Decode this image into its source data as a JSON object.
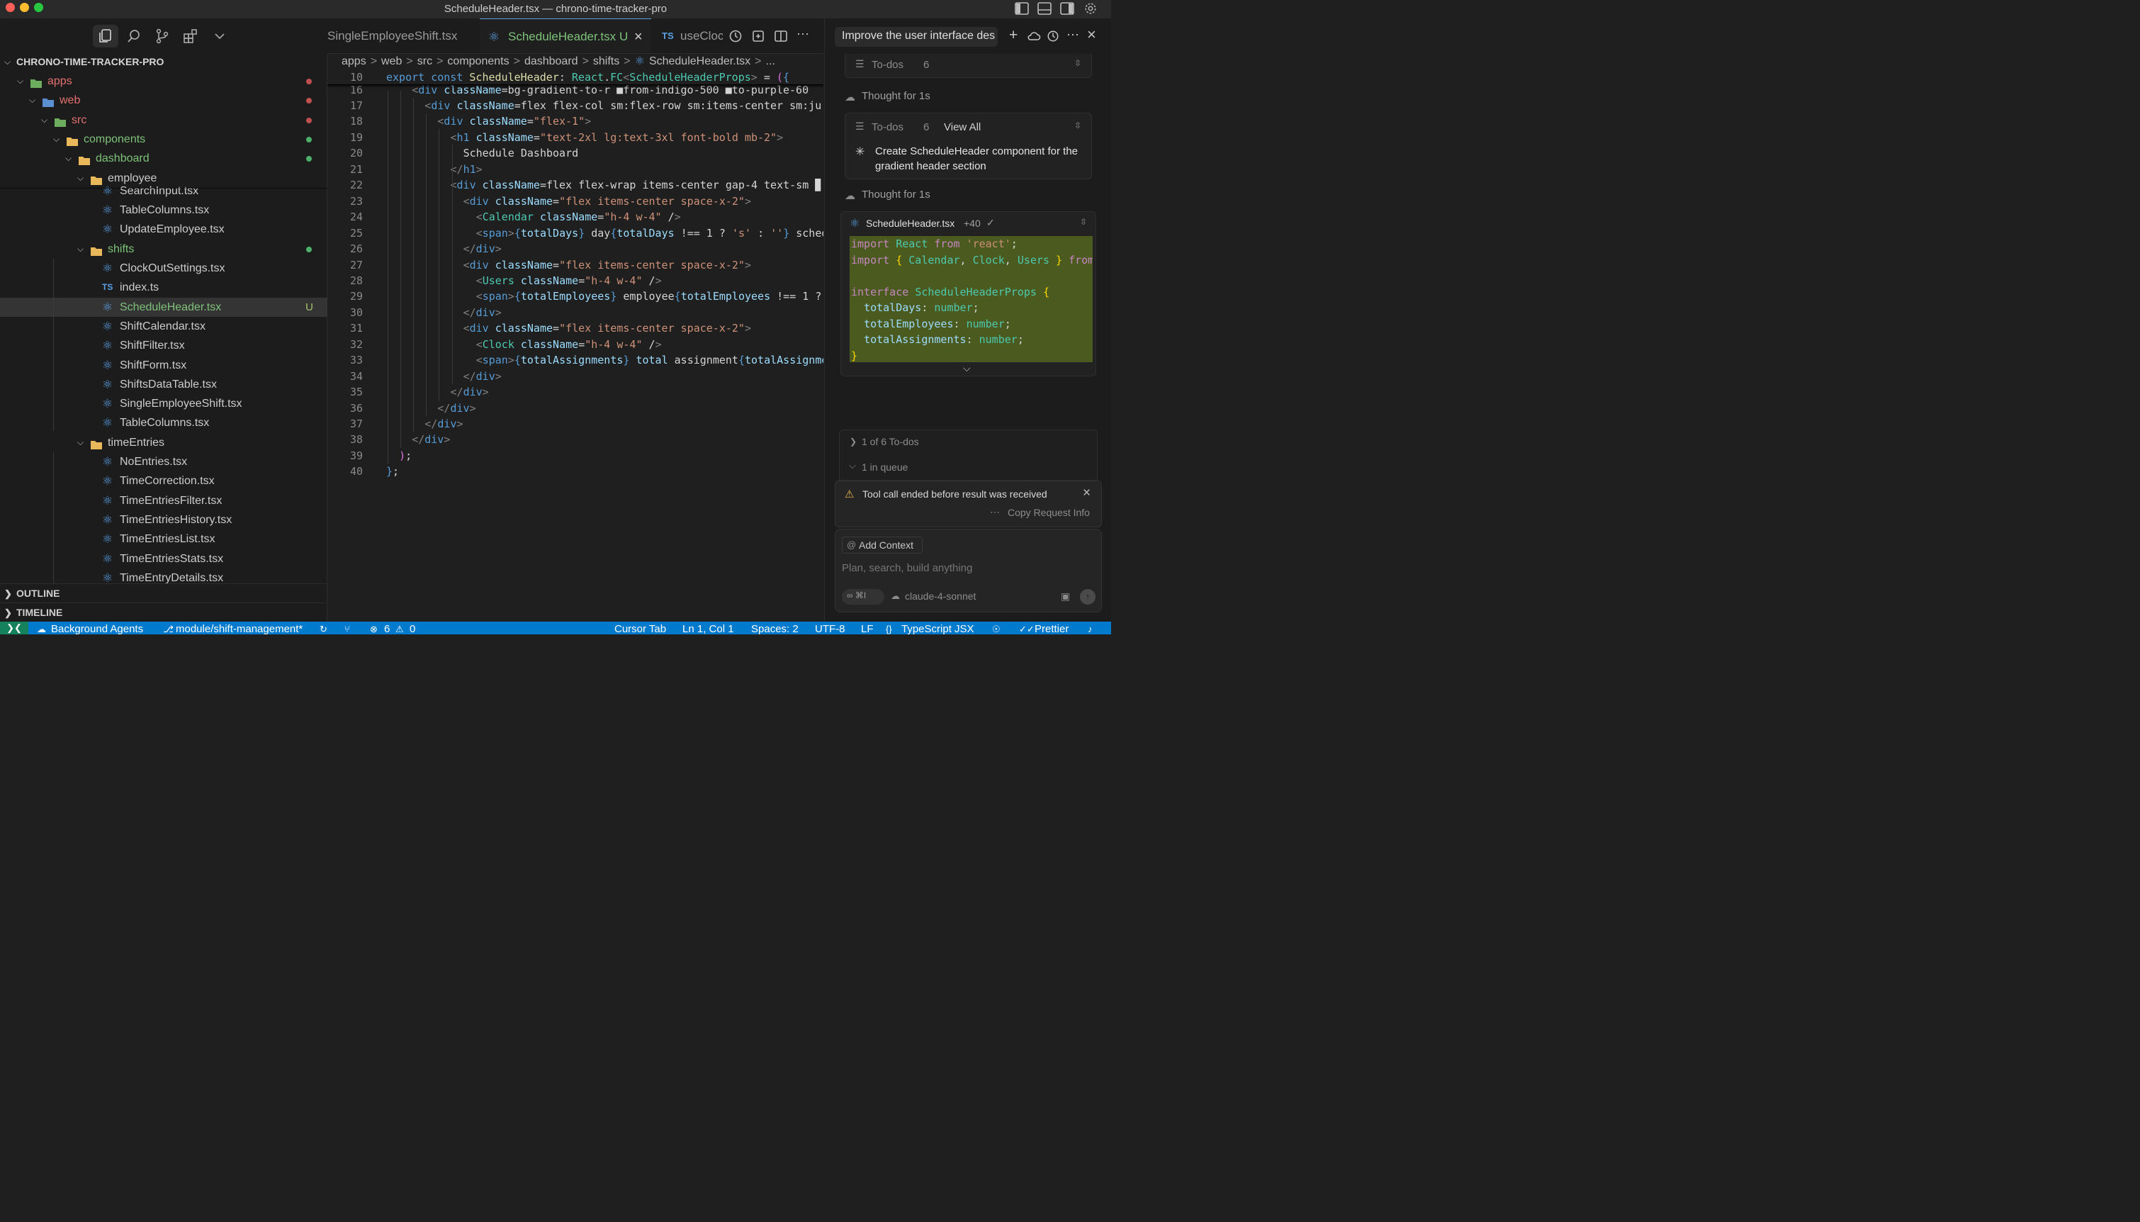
{
  "window": {
    "title": "ScheduleHeader.tsx — chrono-time-tracker-pro"
  },
  "explorer": {
    "root_label": "CHRONO-TIME-TRACKER-PRO",
    "tree": [
      {
        "label": "apps",
        "kind": "folder-apps",
        "open": true,
        "dot": "#c05050",
        "color": "#e46f6f"
      },
      {
        "label": "web",
        "kind": "folder-web",
        "open": true,
        "dot": "#c05050",
        "color": "#e46f6f"
      },
      {
        "label": "src",
        "kind": "folder-src",
        "open": true,
        "dot": "#c05050",
        "color": "#e46f6f"
      },
      {
        "label": "components",
        "kind": "folder-comp",
        "open": true,
        "dot": "#4caf6a",
        "color": "#7ec27a"
      },
      {
        "label": "dashboard",
        "kind": "folder",
        "open": true,
        "dot": "#4caf6a",
        "color": "#7ec27a"
      },
      {
        "label": "employee",
        "kind": "folder",
        "open": true,
        "dot": "",
        "color": "#cccccc"
      },
      {
        "label": "SearchInput.tsx",
        "kind": "react",
        "color": "#cccccc"
      },
      {
        "label": "TableColumns.tsx",
        "kind": "react",
        "color": "#cccccc"
      },
      {
        "label": "UpdateEmployee.tsx",
        "kind": "react",
        "color": "#cccccc"
      },
      {
        "label": "shifts",
        "kind": "folder",
        "open": true,
        "dot": "#4caf6a",
        "color": "#7ec27a"
      },
      {
        "label": "ClockOutSettings.tsx",
        "kind": "react",
        "color": "#cccccc"
      },
      {
        "label": "index.ts",
        "kind": "ts",
        "color": "#cccccc"
      },
      {
        "label": "ScheduleHeader.tsx",
        "kind": "react",
        "color": "#7ec27a",
        "badge": "U",
        "selected": true
      },
      {
        "label": "ShiftCalendar.tsx",
        "kind": "react",
        "color": "#cccccc"
      },
      {
        "label": "ShiftFilter.tsx",
        "kind": "react",
        "color": "#cccccc"
      },
      {
        "label": "ShiftForm.tsx",
        "kind": "react",
        "color": "#cccccc"
      },
      {
        "label": "ShiftsDataTable.tsx",
        "kind": "react",
        "color": "#cccccc"
      },
      {
        "label": "SingleEmployeeShift.tsx",
        "kind": "react",
        "color": "#cccccc"
      },
      {
        "label": "TableColumns.tsx",
        "kind": "react",
        "color": "#cccccc"
      },
      {
        "label": "timeEntries",
        "kind": "folder",
        "open": true,
        "dot": "",
        "color": "#cccccc"
      },
      {
        "label": "NoEntries.tsx",
        "kind": "react",
        "color": "#cccccc"
      },
      {
        "label": "TimeCorrection.tsx",
        "kind": "react",
        "color": "#cccccc"
      },
      {
        "label": "TimeEntriesFilter.tsx",
        "kind": "react",
        "color": "#cccccc"
      },
      {
        "label": "TimeEntriesHistory.tsx",
        "kind": "react",
        "color": "#cccccc"
      },
      {
        "label": "TimeEntriesList.tsx",
        "kind": "react",
        "color": "#cccccc"
      },
      {
        "label": "TimeEntriesStats.tsx",
        "kind": "react",
        "color": "#cccccc"
      },
      {
        "label": "TimeEntryDetails.tsx",
        "kind": "react",
        "color": "#cccccc"
      }
    ],
    "outline_label": "OUTLINE",
    "timeline_label": "TIMELINE"
  },
  "editor": {
    "tabs": [
      {
        "label": "SingleEmployeeShift.tsx",
        "active": false
      },
      {
        "label": "ScheduleHeader.tsx",
        "badge": "U",
        "active": true
      },
      {
        "label": "useCloc",
        "active": false
      }
    ],
    "breadcrumb": [
      "apps",
      "web",
      "src",
      "components",
      "dashboard",
      "shifts",
      "ScheduleHeader.tsx",
      "..."
    ],
    "sticky_line": {
      "no": "10",
      "text": "export const ScheduleHeader: React.FC<ScheduleHeaderProps> = ({"
    },
    "partial_line": {
      "no": "16",
      "text": "<div className=\"bg-gradient-to-r ■from-indigo-500 ■to-purple-60"
    },
    "lines": [
      {
        "no": "17",
        "text": "<div className=\"flex flex-col sm:flex-row sm:items-center sm:ju"
      },
      {
        "no": "18",
        "text": "<div className=\"flex-1\">"
      },
      {
        "no": "19",
        "text": "<h1 className=\"text-2xl lg:text-3xl font-bold mb-2\">"
      },
      {
        "no": "20",
        "text": "Schedule Dashboard"
      },
      {
        "no": "21",
        "text": "</h1>"
      },
      {
        "no": "22",
        "text": "<div className=\"flex flex-wrap items-center gap-4 text-sm ▉"
      },
      {
        "no": "23",
        "text": "<div className=\"flex items-center space-x-2\">"
      },
      {
        "no": "24",
        "text": "<Calendar className=\"h-4 w-4\" />"
      },
      {
        "no": "25",
        "text": "<span>{totalDays} day{totalDays !== 1 ? 's' : ''} sched"
      },
      {
        "no": "26",
        "text": "</div>"
      },
      {
        "no": "27",
        "text": "<div className=\"flex items-center space-x-2\">"
      },
      {
        "no": "28",
        "text": "<Users className=\"h-4 w-4\" />"
      },
      {
        "no": "29",
        "text": "<span>{totalEmployees} employee{totalEmployees !== 1 ?"
      },
      {
        "no": "30",
        "text": "</div>"
      },
      {
        "no": "31",
        "text": "<div className=\"flex items-center space-x-2\">"
      },
      {
        "no": "32",
        "text": "<Clock className=\"h-4 w-4\" />"
      },
      {
        "no": "33",
        "text": "<span>{totalAssignments} total assignment{totalAssignme"
      },
      {
        "no": "34",
        "text": "</div>"
      },
      {
        "no": "35",
        "text": "</div>"
      },
      {
        "no": "36",
        "text": "</div>"
      },
      {
        "no": "37",
        "text": "</div>"
      },
      {
        "no": "38",
        "text": "</div>"
      },
      {
        "no": "39",
        "text": ");"
      },
      {
        "no": "40",
        "text": "};"
      }
    ]
  },
  "chat": {
    "header_title": "Improve the user interface des",
    "todos_collapsed": "To-dos",
    "todos_count": "6",
    "thought_1": "Thought for 1s",
    "todos2_label": "To-dos",
    "todos2_count": "6",
    "view_all": "View All",
    "current_todo": "Create ScheduleHeader component for the gradient header section",
    "thought_2": "Thought for 1s",
    "diff_file": "ScheduleHeader.tsx",
    "diff_stat": "+40",
    "diff_lines": [
      "import React from 'react';",
      "import { Calendar, Clock, Users } from",
      "",
      "interface ScheduleHeaderProps {",
      "  totalDays: number;",
      "  totalEmployees: number;",
      "  totalAssignments: number;",
      "}"
    ],
    "todo_progress": "1 of 6 To-dos",
    "queue": "1 in queue",
    "error_text": "Tool call ended before result was received",
    "copy_request": "Copy Request Info",
    "add_context": "Add Context",
    "input_placeholder": "Plan, search, build anything",
    "mode_label": "∞ ⌘I",
    "model_label": "claude-4-sonnet"
  },
  "statusbar": {
    "agents": "Background Agents",
    "branch": "module/shift-management*",
    "errors": "6",
    "warnings": "0",
    "cursor_tab": "Cursor Tab",
    "position": "Ln 1, Col 1",
    "spaces": "Spaces: 2",
    "encoding": "UTF-8",
    "eol": "LF",
    "language": "TypeScript JSX",
    "formatter": "Prettier"
  },
  "colors": {
    "accent": "#007acc",
    "untracked": "#7ec27a",
    "modified": "#e46f6f",
    "diff_bg": "#4b5a1e"
  }
}
